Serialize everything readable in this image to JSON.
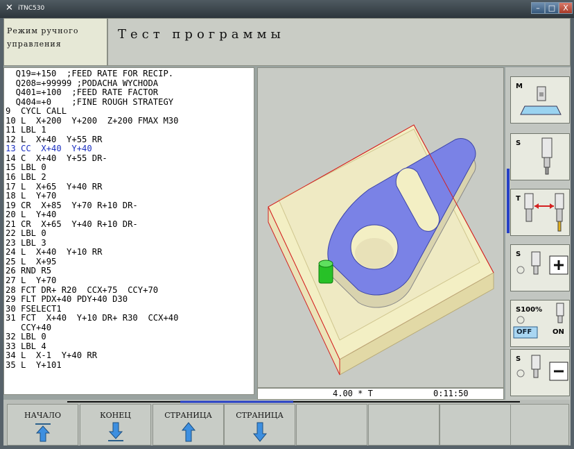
{
  "window": {
    "title": "iTNC530",
    "min": "–",
    "max": "□",
    "close": "X"
  },
  "mode": {
    "line1": "Режим ручного",
    "line2": "управления"
  },
  "title": "Тест программы",
  "program_lines": [
    "  Q19=+150  ;FEED RATE FOR RECIP.",
    "  Q208=+99999 ;PODACHA WYCHODA",
    "  Q401=+100  ;FEED RATE FACTOR",
    "  Q404=+0    ;FINE ROUGH STRATEGY",
    "9  CYCL CALL",
    "10 L  X+200  Y+200  Z+200 FMAX M30",
    "11 LBL 1",
    "12 L  X+40  Y+55 RR",
    "13 CC  X+40  Y+40",
    "14 C  X+40  Y+55 DR-",
    "15 LBL 0",
    "16 LBL 2",
    "17 L  X+65  Y+40 RR",
    "18 L  Y+70",
    "19 CR  X+85  Y+70 R+10 DR-",
    "20 L  Y+40",
    "21 CR  X+65  Y+40 R+10 DR-",
    "22 LBL 0",
    "23 LBL 3",
    "24 L  X+40  Y+10 RR",
    "25 L  X+95",
    "26 RND R5",
    "27 L  Y+70",
    "28 FCT DR+ R20  CCX+75  CCY+70",
    "29 FLT PDX+40 PDY+40 D30",
    "30 FSELECT1",
    "31 FCT  X+40  Y+10 DR+ R30  CCX+40",
    "   CCY+40",
    "32 LBL 0",
    "33 LBL 4",
    "34 L  X-1  Y+40 RR",
    "35 L  Y+101"
  ],
  "highlighted_line": 8,
  "status": {
    "factor": "4.00 * T",
    "time": "0:11:50"
  },
  "softkeys_right": {
    "m_label": "M",
    "s_label": "S",
    "t_label": "T",
    "s_plus_label": "S",
    "s100_label": "S100%",
    "off": "OFF",
    "on": "ON",
    "s_minus_label": "S"
  },
  "function_keys": [
    {
      "label": "НАЧАЛО",
      "icon": "arrow-up-bar-icon"
    },
    {
      "label": "КОНЕЦ",
      "icon": "arrow-down-bar-icon"
    },
    {
      "label": "СТРАНИЦА",
      "icon": "arrow-up-icon"
    },
    {
      "label": "СТРАНИЦА",
      "icon": "arrow-down-icon"
    },
    {
      "label": "",
      "icon": ""
    },
    {
      "label": "",
      "icon": ""
    },
    {
      "label": "",
      "icon": ""
    },
    {
      "label": "",
      "icon": ""
    }
  ],
  "colors": {
    "accent_blue": "#2640c7",
    "part_top": "#7a82e6",
    "stock": "#f3efc4",
    "tool": "#27c127",
    "outline_red": "#d42020"
  }
}
